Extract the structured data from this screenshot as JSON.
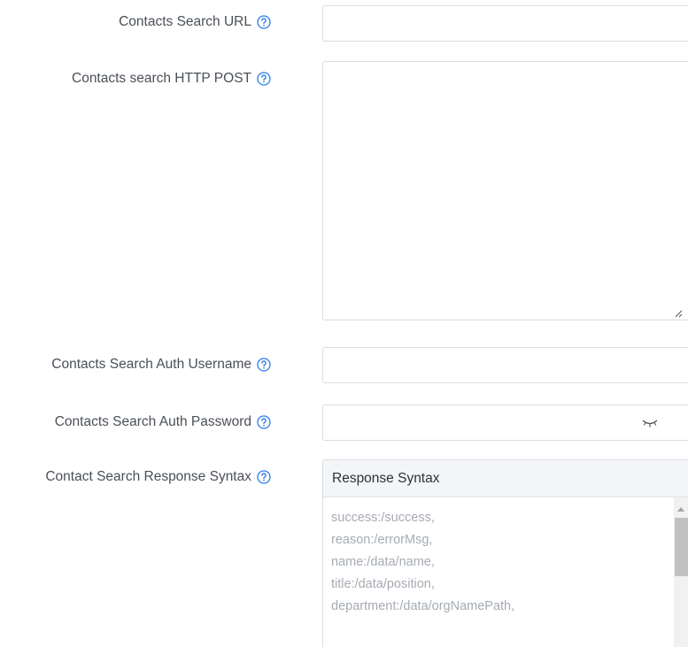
{
  "fields": {
    "search_url": {
      "label": "Contacts Search URL",
      "value": ""
    },
    "http_post": {
      "label": "Contacts search HTTP POST",
      "value": ""
    },
    "auth_username": {
      "label": "Contacts Search Auth Username",
      "value": ""
    },
    "auth_password": {
      "label": "Contacts Search Auth Password",
      "value": ""
    },
    "response_syntax": {
      "label": "Contact Search Response Syntax",
      "header": "Response Syntax",
      "lines": [
        "success:/success,",
        "reason:/errorMsg,",
        "name:/data/name,",
        "title:/data/position,",
        "department:/data/orgNamePath,"
      ]
    }
  },
  "icons": {
    "help": "question-circle-icon",
    "password_toggle": "eye-closed-icon"
  },
  "colors": {
    "accent": "#2b7de9",
    "label_text": "#4a4f57",
    "border": "#d9dce1",
    "placeholder_text": "#a6abb2"
  }
}
